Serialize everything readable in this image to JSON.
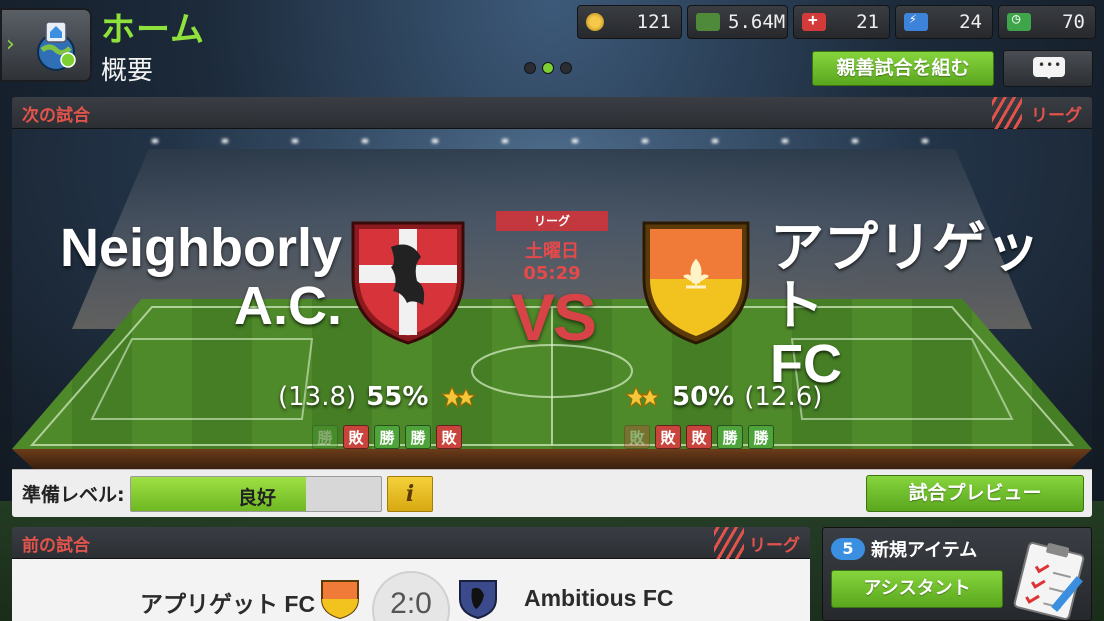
{
  "header": {
    "title": "ホーム",
    "subtitle": "概要",
    "back_chevron": "›",
    "page_dots": 3,
    "active_dot": 1
  },
  "currencies": [
    {
      "icon": "token-icon",
      "value": "121"
    },
    {
      "icon": "cash-icon",
      "value": "5.64M"
    },
    {
      "icon": "medical-icon",
      "value": "21"
    },
    {
      "icon": "energy-icon",
      "value": "24"
    },
    {
      "icon": "clock-icon",
      "value": "70"
    }
  ],
  "actions": {
    "friendly_label": "親善試合を組む",
    "chat_icon": "chat-bubble-icon",
    "chat_dots": "•••"
  },
  "next_match": {
    "title": "次の試合",
    "competition_tag": "リーグ",
    "chip_label": "リーグ",
    "day": "土曜日",
    "time": "05:29",
    "vs": "VS",
    "home": {
      "name_line1": "Neighborly",
      "name_line2": "A.C.",
      "rating": "(13.8)",
      "percent": "55%",
      "form": [
        "勝",
        "敗",
        "勝",
        "勝",
        "敗"
      ],
      "form_result": [
        "W",
        "L",
        "W",
        "W",
        "L"
      ]
    },
    "away": {
      "name_line1": "アプリゲット",
      "name_line2": "FC",
      "rating": "(12.6)",
      "percent": "50%",
      "form": [
        "敗",
        "敗",
        "敗",
        "勝",
        "勝"
      ],
      "form_result": [
        "L",
        "L",
        "L",
        "W",
        "W"
      ]
    },
    "preparation": {
      "label": "準備レベル:",
      "value_text": "良好",
      "fill_fraction": 0.7,
      "info_label": "i",
      "preview_button": "試合プレビュー"
    }
  },
  "previous_match": {
    "title": "前の試合",
    "competition_tag": "リーグ",
    "home_name": "アプリゲット FC",
    "score": "2:0",
    "away_name": "Ambitious FC"
  },
  "new_items": {
    "count": "5",
    "title": "新規アイテム",
    "button_label": "アシスタント"
  },
  "colors": {
    "accent_green": "#8fe23c",
    "accent_red": "#e2534c",
    "home_crest": "#d6333a",
    "away_crest_top": "#f07a38",
    "away_crest_bottom": "#f2c21e"
  }
}
